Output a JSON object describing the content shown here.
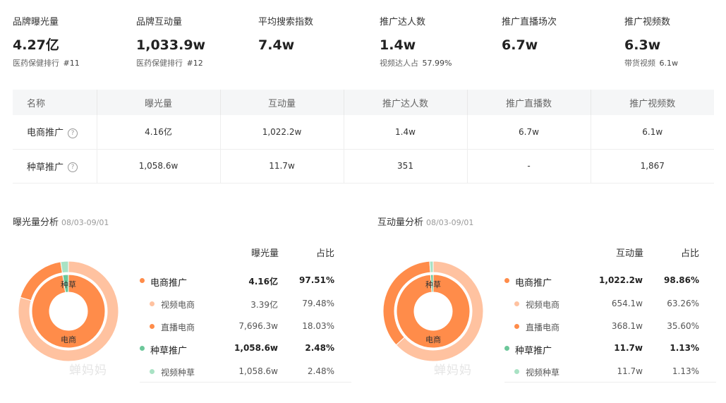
{
  "kpis": [
    {
      "label": "品牌曝光量",
      "value": "4.27亿",
      "sub_label": "医药保健排行",
      "sub_value": "#11"
    },
    {
      "label": "品牌互动量",
      "value": "1,033.9w",
      "sub_label": "医药保健排行",
      "sub_value": "#12"
    },
    {
      "label": "平均搜索指数",
      "value": "7.4w",
      "sub_label": "",
      "sub_value": ""
    },
    {
      "label": "推广达人数",
      "value": "1.4w",
      "sub_label": "视频达人占",
      "sub_value": "57.99%"
    },
    {
      "label": "推广直播场次",
      "value": "6.7w",
      "sub_label": "",
      "sub_value": ""
    },
    {
      "label": "推广视频数",
      "value": "6.3w",
      "sub_label": "带货视频",
      "sub_value": "6.1w"
    }
  ],
  "table": {
    "headers": [
      "名称",
      "曝光量",
      "互动量",
      "推广达人数",
      "推广直播数",
      "推广视频数"
    ],
    "rows": [
      {
        "name": "电商推广",
        "cells": [
          "4.16亿",
          "1,022.2w",
          "1.4w",
          "6.7w",
          "6.1w"
        ]
      },
      {
        "name": "种草推广",
        "cells": [
          "1,058.6w",
          "11.7w",
          "351",
          "-",
          "1,867"
        ]
      }
    ],
    "help_glyph": "?"
  },
  "panels": [
    {
      "title": "曝光量分析",
      "range": "08/03-09/01",
      "col1": "曝光量",
      "col2": "占比",
      "inner_labels": [
        "种草",
        "电商"
      ],
      "watermark": "蝉妈妈",
      "rows": [
        {
          "name": "电商推广",
          "v1": "4.16亿",
          "v2": "97.51%",
          "level": "main",
          "color": "#ff8c4a",
          "share": 97.51
        },
        {
          "name": "视频电商",
          "v1": "3.39亿",
          "v2": "79.48%",
          "level": "sub",
          "color": "#ffc2a0",
          "share": 79.48
        },
        {
          "name": "直播电商",
          "v1": "7,696.3w",
          "v2": "18.03%",
          "level": "sub",
          "color": "#ff8c4a",
          "share": 18.03
        },
        {
          "name": "种草推广",
          "v1": "1,058.6w",
          "v2": "2.48%",
          "level": "main",
          "color": "#6cc79a",
          "share": 2.48
        },
        {
          "name": "视频种草",
          "v1": "1,058.6w",
          "v2": "2.48%",
          "level": "sub",
          "color": "#a9e2c4",
          "share": 2.48
        }
      ]
    },
    {
      "title": "互动量分析",
      "range": "08/03-09/01",
      "col1": "互动量",
      "col2": "占比",
      "inner_labels": [
        "种草",
        "电商"
      ],
      "watermark": "蝉妈妈",
      "rows": [
        {
          "name": "电商推广",
          "v1": "1,022.2w",
          "v2": "98.86%",
          "level": "main",
          "color": "#ff8c4a",
          "share": 98.86
        },
        {
          "name": "视频电商",
          "v1": "654.1w",
          "v2": "63.26%",
          "level": "sub",
          "color": "#ffc2a0",
          "share": 63.26
        },
        {
          "name": "直播电商",
          "v1": "368.1w",
          "v2": "35.60%",
          "level": "sub",
          "color": "#ff8c4a",
          "share": 35.6
        },
        {
          "name": "种草推广",
          "v1": "11.7w",
          "v2": "1.13%",
          "level": "main",
          "color": "#6cc79a",
          "share": 1.13
        },
        {
          "name": "视频种草",
          "v1": "11.7w",
          "v2": "1.13%",
          "level": "sub",
          "color": "#a9e2c4",
          "share": 1.13
        }
      ]
    }
  ],
  "colors": {
    "accent_orange": "#ff8c4a",
    "light_orange": "#ffc2a0",
    "green": "#6cc79a",
    "light_green": "#a9e2c4"
  }
}
